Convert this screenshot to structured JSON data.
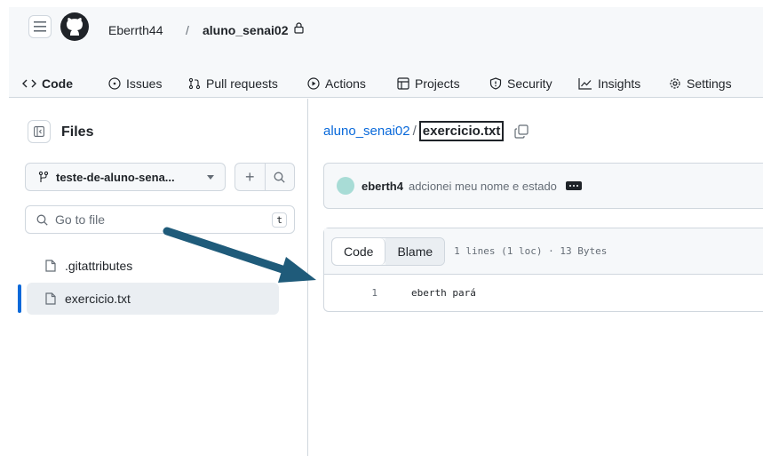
{
  "header": {
    "owner": "Eberrth44",
    "separator": "/",
    "repo": "aluno_senai02"
  },
  "tabs": [
    {
      "label": "Code",
      "icon": "code-icon",
      "active": true
    },
    {
      "label": "Issues",
      "icon": "issue-icon"
    },
    {
      "label": "Pull requests",
      "icon": "pull-request-icon"
    },
    {
      "label": "Actions",
      "icon": "play-icon"
    },
    {
      "label": "Projects",
      "icon": "table-icon"
    },
    {
      "label": "Security",
      "icon": "shield-icon"
    },
    {
      "label": "Insights",
      "icon": "graph-icon"
    },
    {
      "label": "Settings",
      "icon": "gear-icon"
    }
  ],
  "sidebar": {
    "title": "Files",
    "branch": "teste-de-aluno-sena...",
    "search_placeholder": "Go to file",
    "search_shortcut": "t",
    "files": [
      {
        "name": ".gitattributes",
        "selected": false
      },
      {
        "name": "exercicio.txt",
        "selected": true
      }
    ]
  },
  "main": {
    "path_repo": "aluno_senai02",
    "path_sep": "/",
    "path_file": "exercicio.txt",
    "commit": {
      "author": "eberth4",
      "message": "adcionei meu nome e estado"
    },
    "viewer": {
      "tab_code": "Code",
      "tab_blame": "Blame",
      "meta": "1 lines (1 loc) · 13 Bytes",
      "lines": [
        {
          "number": "1",
          "content": "eberth pará"
        }
      ]
    }
  },
  "colors": {
    "accent": "#0969da",
    "active_tab_underline": "#fd8c73",
    "annotation_arrow": "#1f5b7a"
  }
}
